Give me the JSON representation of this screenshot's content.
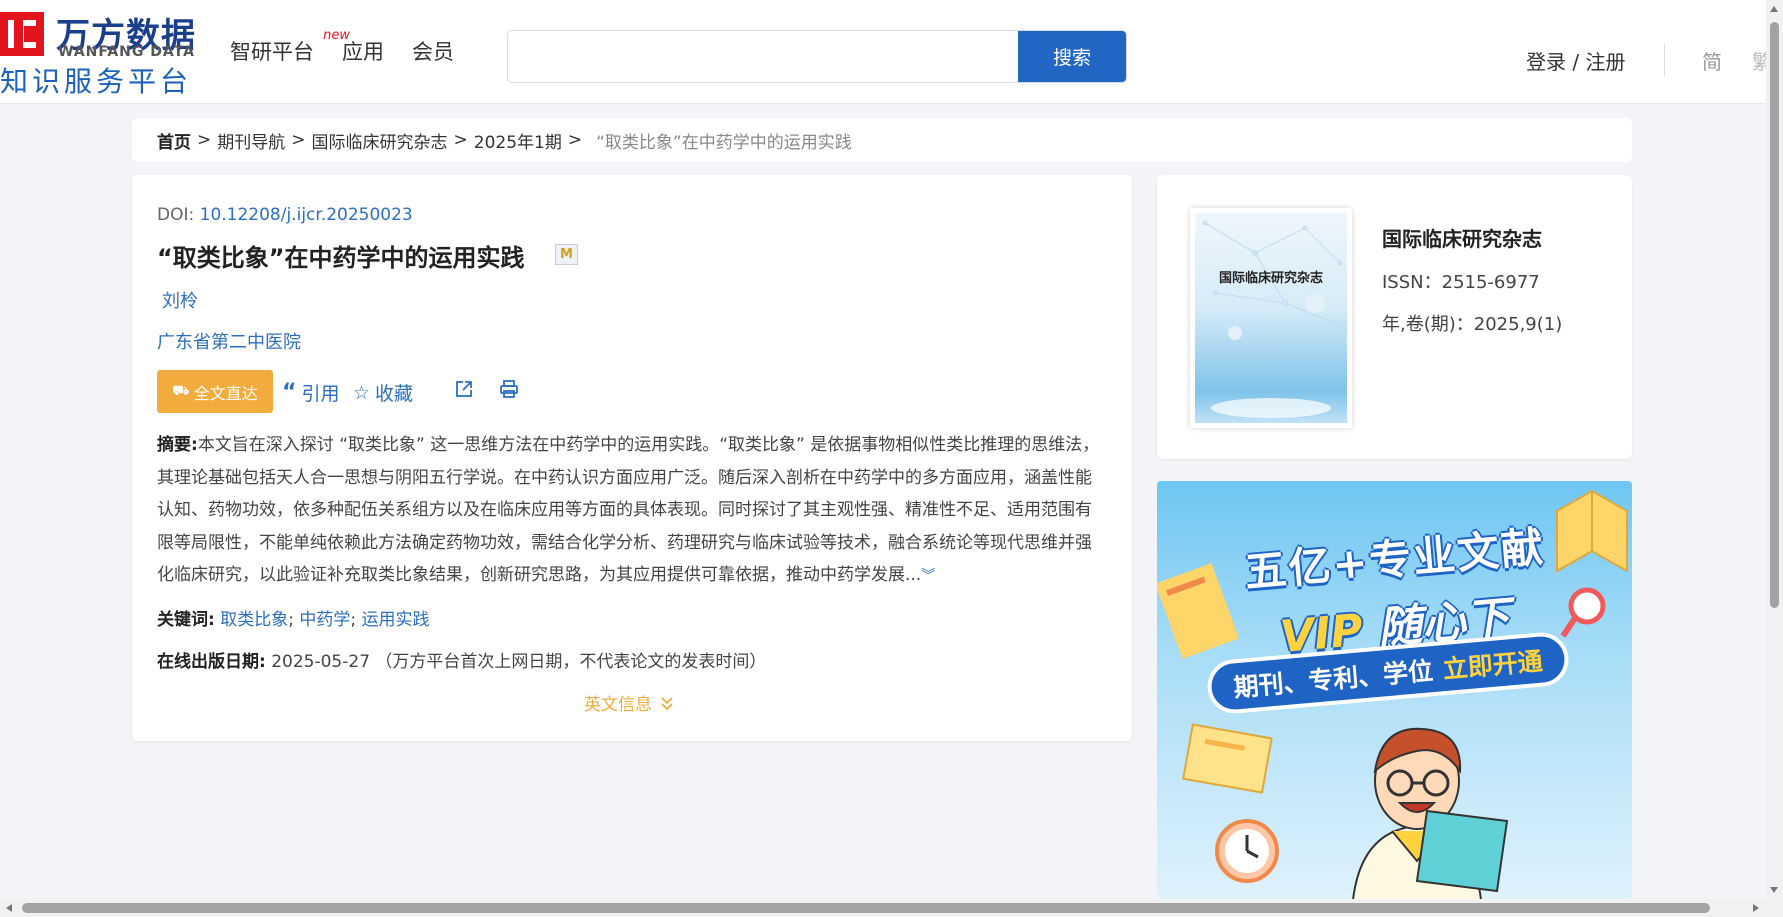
{
  "header": {
    "logo_cn": "万方数据",
    "logo_en": "WANFANG DATA",
    "logo_sub": "知识服务平台",
    "nav": [
      {
        "label": "智研平台",
        "badge": "new"
      },
      {
        "label": "应用"
      },
      {
        "label": "会员"
      }
    ],
    "search": {
      "value": "",
      "button": "搜索"
    },
    "login": "登录 / 注册",
    "lang_simple": "简",
    "lang_trad": "繁"
  },
  "breadcrumb": {
    "items": [
      "首页",
      "期刊导航",
      "国际临床研究杂志",
      "2025年1期"
    ],
    "separator": ">",
    "current": "“取类比象”在中药学中的运用实践"
  },
  "article": {
    "doi_label": "DOI:",
    "doi": "10.12208/j.ijcr.20250023",
    "title": "“取类比象”在中药学中的运用实践",
    "badge": "M",
    "author": "刘柃",
    "organization": "广东省第二中医院",
    "actions": {
      "fulltext": "全文直达",
      "cite": "引用",
      "favorite": "收藏"
    },
    "abstract_label": "摘要:",
    "abstract": "本文旨在深入探讨 “取类比象” 这一思维方法在中药学中的运用实践。“取类比象” 是依据事物相似性类比推理的思维法，其理论基础包括天人合一思想与阴阳五行学说。在中药认识方面应用广泛。随后深入剖析在中药学中的多方面应用，涵盖性能认知、药物功效，依多种配伍关系组方以及在临床应用等方面的具体表现。同时探讨了其主观性强、精准性不足、适用范围有限等局限性，不能单纯依赖此方法确定药物功效，需结合化学分析、药理研究与临床试验等技术，融合系统论等现代思维并强化临床研究，以此验证补充取类比象结果，创新研究思路，为其应用提供可靠依据，推动中药学发展...",
    "keywords_label": "关键词:",
    "keywords": [
      "取类比象",
      "中药学",
      "运用实践"
    ],
    "pubdate_label": "在线出版日期:",
    "pubdate": "2025-05-27",
    "pubdate_note": "（万方平台首次上网日期，不代表论文的发表时间）",
    "english_info": "英文信息"
  },
  "journal": {
    "name": "国际临床研究杂志",
    "cover_title": "国际临床研究杂志",
    "issn": "ISSN：2515-6977",
    "volume": "年,卷(期)：2025,9(1)"
  },
  "ad": {
    "line1": "五亿+专业文献",
    "line2_vip": "VIP",
    "line2_rest": " 随心下",
    "pill_left": "期刊、专利、学位",
    "pill_right": "立即开通"
  },
  "colors": {
    "brand_blue": "#2066c2",
    "link_blue": "#2d6fbf",
    "accent_orange": "#f2ac3d",
    "logo_red": "#e3151c"
  }
}
